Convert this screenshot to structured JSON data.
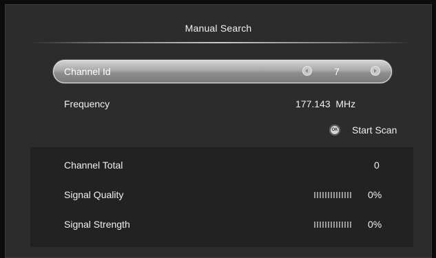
{
  "dialog": {
    "title": "Manual Search"
  },
  "channel_id": {
    "label": "Channel Id",
    "value": "7"
  },
  "frequency": {
    "label": "Frequency",
    "value": "177.143  MHz"
  },
  "start_scan": {
    "label": "Start Scan",
    "key_icon": "ok-button-icon",
    "key_text": "OK"
  },
  "results": {
    "channel_total": {
      "label": "Channel Total",
      "value": "0"
    },
    "signal_quality": {
      "label": "Signal Quality",
      "value": "0%",
      "level_fraction": 0
    },
    "signal_strength": {
      "label": "Signal Strength",
      "value": "0%",
      "level_fraction": 0
    }
  },
  "colors": {
    "background": "#2c2c2c",
    "results_panel": "#222222",
    "highlight": "#a8a8a8"
  }
}
